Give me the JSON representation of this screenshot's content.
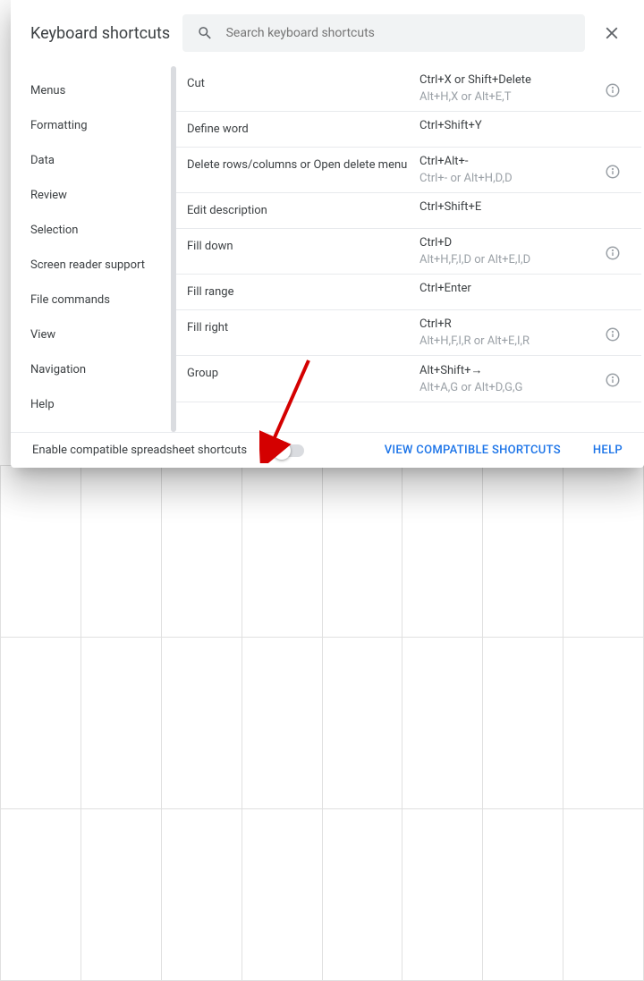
{
  "dialog": {
    "title": "Keyboard shortcuts",
    "search_placeholder": "Search keyboard shortcuts"
  },
  "sidebar": {
    "items": [
      {
        "label": "Menus"
      },
      {
        "label": "Formatting"
      },
      {
        "label": "Data"
      },
      {
        "label": "Review"
      },
      {
        "label": "Selection"
      },
      {
        "label": "Screen reader support"
      },
      {
        "label": "File commands"
      },
      {
        "label": "View"
      },
      {
        "label": "Navigation"
      },
      {
        "label": "Help"
      }
    ]
  },
  "shortcuts": [
    {
      "action": "Cut",
      "primary": "Ctrl+X or Shift+Delete",
      "alt": "Alt+H,X or Alt+E,T",
      "info": true
    },
    {
      "action": "Define word",
      "primary": "Ctrl+Shift+Y",
      "alt": "",
      "info": false
    },
    {
      "action": "Delete rows/columns or Open delete menu",
      "primary": "Ctrl+Alt+-",
      "alt": "Ctrl+- or Alt+H,D,D",
      "info": true
    },
    {
      "action": "Edit description",
      "primary": "Ctrl+Shift+E",
      "alt": "",
      "info": false
    },
    {
      "action": "Fill down",
      "primary": "Ctrl+D",
      "alt": "Alt+H,F,I,D or Alt+E,I,D",
      "info": true
    },
    {
      "action": "Fill range",
      "primary": "Ctrl+Enter",
      "alt": "",
      "info": false
    },
    {
      "action": "Fill right",
      "primary": "Ctrl+R",
      "alt": "Alt+H,F,I,R or Alt+E,I,R",
      "info": true
    },
    {
      "action": "Group",
      "primary": "Alt+Shift+→",
      "alt": "Alt+A,G or Alt+D,G,G",
      "info": true
    }
  ],
  "footer": {
    "toggle_label": "Enable compatible spreadsheet shortcuts",
    "view_compatible": "VIEW COMPATIBLE SHORTCUTS",
    "help": "HELP"
  }
}
